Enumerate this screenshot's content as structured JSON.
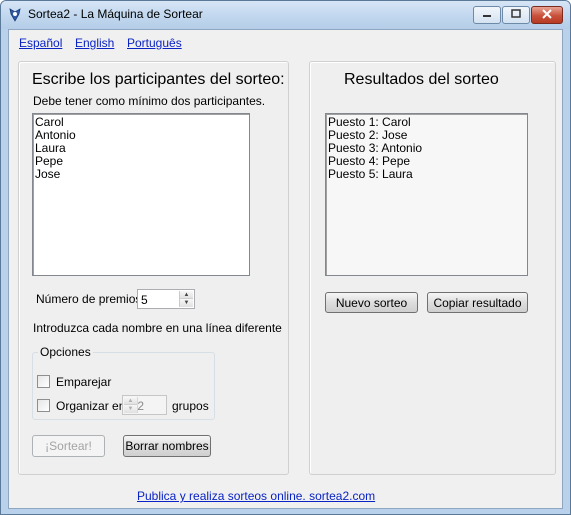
{
  "window": {
    "title": "Sortea2 - La Máquina de Sortear"
  },
  "languages": [
    "Español",
    "English",
    "Português"
  ],
  "left": {
    "heading": "Escribe los participantes del sorteo:",
    "hint": "Debe tener como mínimo dos participantes.",
    "participants": [
      "Carol",
      "Antonio",
      "Laura",
      "Pepe",
      "Jose"
    ],
    "prizes_label": "Número de premios:",
    "prizes_value": "5",
    "instruction": "Introduzca cada nombre en una línea diferente",
    "options": {
      "legend": "Opciones",
      "pair_label": "Emparejar",
      "pair_checked": false,
      "organize_label": "Organizar en",
      "organize_checked": false,
      "groups_value": "2",
      "groups_label": "grupos"
    },
    "draw_button": "¡Sortear!",
    "clear_button": "Borrar nombres"
  },
  "right": {
    "heading": "Resultados del sorteo",
    "results": [
      "Puesto 1: Carol",
      "Puesto 2: Jose",
      "Puesto 3: Antonio",
      "Puesto 4: Pepe",
      "Puesto 5: Laura"
    ],
    "new_button": "Nuevo sorteo",
    "copy_button": "Copiar resultado"
  },
  "footer": {
    "link": "Publica y realiza sorteos online.  sortea2.com"
  }
}
